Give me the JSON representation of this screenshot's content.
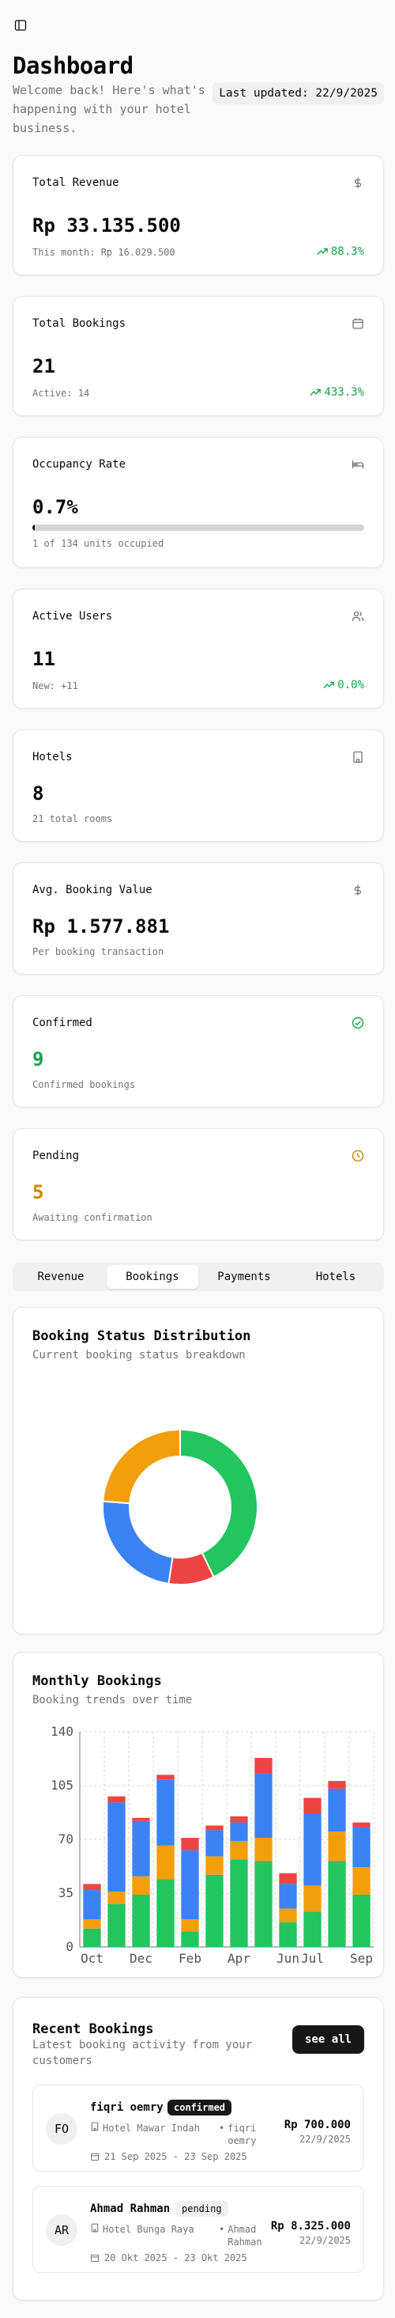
{
  "header": {
    "title": "Dashboard",
    "subtitle": "Welcome back! Here's what's happening with your hotel business.",
    "last_updated": "Last updated: 22/9/2025"
  },
  "stats": {
    "revenue": {
      "label": "Total Revenue",
      "icon": "dollar-icon",
      "value": "Rp 33.135.500",
      "sub": "This month: Rp 16.029.500",
      "trend": "88.3%"
    },
    "bookings": {
      "label": "Total Bookings",
      "icon": "calendar-icon",
      "value": "21",
      "sub": "Active: 14",
      "trend": "433.3%"
    },
    "occupancy": {
      "label": "Occupancy Rate",
      "icon": "bed-icon",
      "value": "0.7%",
      "sub": "1 of 134 units occupied",
      "progress": 0.007
    },
    "users": {
      "label": "Active Users",
      "icon": "users-icon",
      "value": "11",
      "sub": "New: +11",
      "trend": "0.0%"
    },
    "hotels": {
      "label": "Hotels",
      "icon": "building-icon",
      "value": "8",
      "sub": "21 total rooms"
    },
    "avg_booking": {
      "label": "Avg. Booking Value",
      "icon": "dollar-icon",
      "value": "Rp 1.577.881",
      "sub": "Per booking transaction"
    },
    "confirmed": {
      "label": "Confirmed",
      "icon": "check-circle-icon",
      "value": "9",
      "sub": "Confirmed bookings",
      "color": "#16a34a"
    },
    "pending": {
      "label": "Pending",
      "icon": "clock-icon",
      "value": "5",
      "sub": "Awaiting confirmation",
      "color": "#ca8a04"
    }
  },
  "tabs": [
    {
      "label": "Revenue",
      "active": false
    },
    {
      "label": "Bookings",
      "active": true
    },
    {
      "label": "Payments",
      "active": false
    },
    {
      "label": "Hotels",
      "active": false
    }
  ],
  "status_card": {
    "title": "Booking Status Distribution",
    "description": "Current booking status breakdown"
  },
  "monthly_card": {
    "title": "Monthly Bookings",
    "description": "Booking trends over time"
  },
  "colors": {
    "green": "#22c55e",
    "red": "#ef4444",
    "blue": "#3b82f6",
    "orange": "#f59e0b"
  },
  "chart_data": [
    {
      "type": "pie",
      "title": "",
      "labels": [
        "",
        "",
        "",
        ""
      ],
      "values": [
        9,
        2,
        5,
        5
      ],
      "colors": [
        "#22c55e",
        "#ef4444",
        "#3b82f6",
        "#f59e0b"
      ]
    },
    {
      "type": "bar",
      "stacked": true,
      "title": "",
      "x_tick_labels": [
        "Oct",
        "Dec",
        "Feb",
        "Apr",
        "Jun",
        "Jul",
        "Sep"
      ],
      "ylim": [
        0,
        140
      ],
      "y_ticks": [
        0,
        35,
        70,
        105,
        140
      ],
      "grid": true,
      "series": [
        {
          "values": [
            12,
            28,
            34,
            44,
            10,
            47,
            57,
            56,
            16,
            23,
            56,
            34
          ],
          "color": "#22c55e"
        },
        {
          "values": [
            6,
            8,
            12,
            22,
            8,
            12,
            12,
            15,
            9,
            17,
            19,
            18
          ],
          "color": "#f59e0b"
        },
        {
          "values": [
            19,
            58,
            36,
            43,
            45,
            17,
            12,
            42,
            16,
            47,
            28,
            26
          ],
          "color": "#3b82f6"
        },
        {
          "values": [
            4,
            4,
            2,
            3,
            8,
            3,
            4,
            10,
            7,
            10,
            5,
            3
          ],
          "color": "#ef4444"
        }
      ]
    }
  ],
  "recent": {
    "title": "Recent Bookings",
    "description": "Latest booking activity from your customers",
    "see_all": "see all",
    "items": [
      {
        "initials": "FO",
        "name": "fiqri oemry",
        "status": "confirmed",
        "hotel": "Hotel Mawar Indah",
        "guest": "fiqri oemry",
        "dates": "21 Sep 2025 - 23 Sep 2025",
        "amount": "Rp 700.000",
        "date": "22/9/2025"
      },
      {
        "initials": "AR",
        "name": "Ahmad Rahman",
        "status": "pending",
        "hotel": "Hotel Bunga Raya",
        "guest": "Ahmad Rahman",
        "dates": "20 Okt 2025 - 23 Okt 2025",
        "amount": "Rp 8.325.000",
        "date": "22/9/2025"
      }
    ]
  }
}
